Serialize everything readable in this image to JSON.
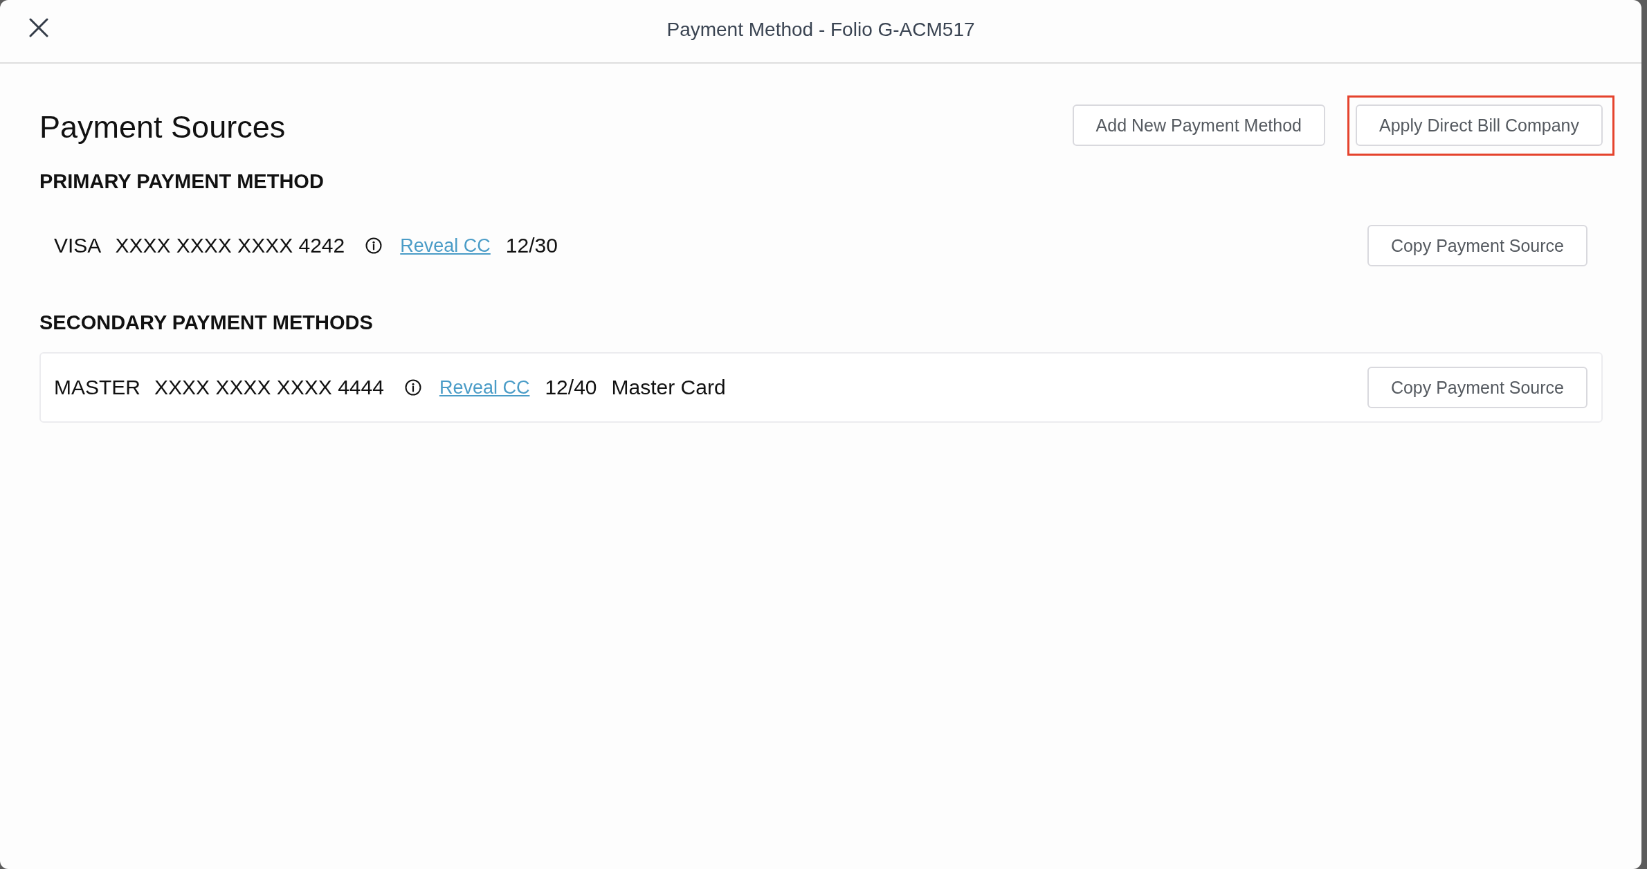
{
  "dialog": {
    "title": "Payment Method - Folio G-ACM517"
  },
  "section_title": "Payment Sources",
  "actions": [
    {
      "label": "Add New Payment Method",
      "highlighted": false
    },
    {
      "label": "Apply Direct Bill Company",
      "highlighted": true
    }
  ],
  "sections": [
    {
      "kind": "primary",
      "heading": "PRIMARY PAYMENT METHOD",
      "methods": [
        {
          "card_type": "VISA",
          "number": "XXXX XXXX XXXX 4242",
          "reveal_link": "Reveal CC",
          "expiry": "12/30",
          "button": "Copy Payment Source"
        }
      ]
    },
    {
      "kind": "secondary",
      "heading": "SECONDARY PAYMENT METHODS",
      "methods": [
        {
          "card_type": "MASTER",
          "number": "XXXX XXXX XXXX 4444",
          "reveal_link": "Reveal CC",
          "expiry": "12/40",
          "description": "Master Card",
          "button": "Copy Payment Source"
        }
      ]
    }
  ]
}
